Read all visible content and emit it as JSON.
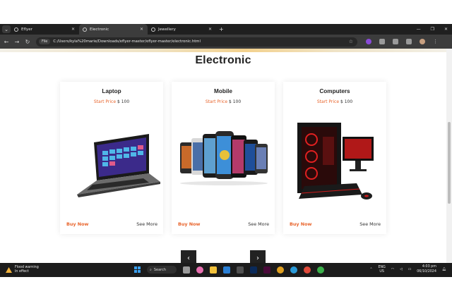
{
  "browser": {
    "tabs": [
      {
        "label": "Eflyer",
        "active": false
      },
      {
        "label": "Electronic",
        "active": true
      },
      {
        "label": "Jewellery",
        "active": false
      }
    ],
    "url": "C:/Users/kyla%20marie/Downloads/eflyer-master/eflyer-master/electronic.html",
    "file_chip": "File"
  },
  "page": {
    "title": "Electronic",
    "cards": [
      {
        "title": "Laptop",
        "price_label": "Start Price",
        "price": "$ 100",
        "buy": "Buy Now",
        "more": "See More",
        "image": "laptop-image"
      },
      {
        "title": "Mobile",
        "price_label": "Start Price",
        "price": "$ 100",
        "buy": "Buy Now",
        "more": "See More",
        "image": "mobile-phones-image"
      },
      {
        "title": "Computers",
        "price_label": "Start Price",
        "price": "$ 100",
        "buy": "Buy Now",
        "more": "See More",
        "image": "gaming-computer-image"
      }
    ],
    "pager": {
      "prev": "‹",
      "next": "›"
    }
  },
  "taskbar": {
    "weather_title": "Flood warning",
    "weather_sub": "In effect",
    "search_label": "Search",
    "lang_top": "ENG",
    "lang_bottom": "US",
    "time": "4:03 pm",
    "date": "06/10/2024"
  },
  "colors": {
    "accent": "#e8632a",
    "chrome": "#3c3c3c",
    "taskbar": "#1c1c1c"
  }
}
